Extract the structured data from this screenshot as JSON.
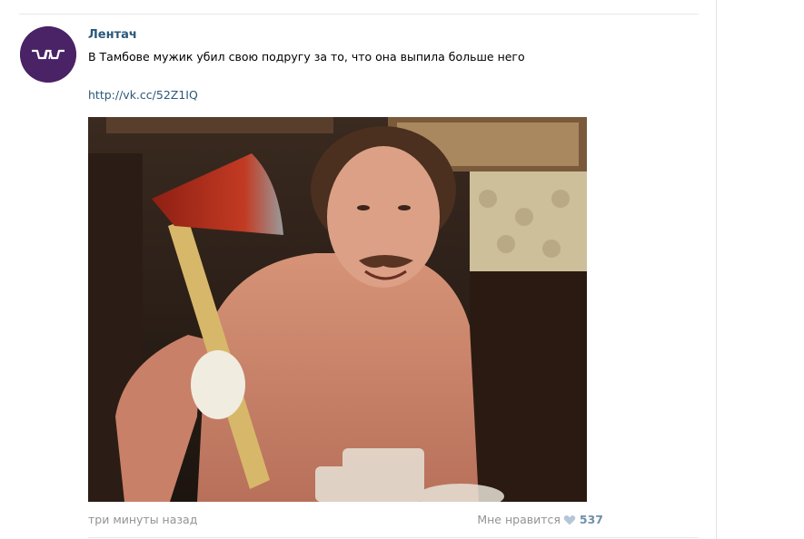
{
  "post": {
    "author": "Лентач",
    "text": "В Тамбове мужик убил свою подругу за то, что она выпила больше него",
    "link": "http://vk.cc/52Z1IQ",
    "timestamp": "три минуты назад",
    "like_label": "Мне нравится",
    "like_count": "537"
  },
  "icons": {
    "avatar": "lentach-logo",
    "like": "heart-icon"
  },
  "colors": {
    "link": "#2b587a",
    "muted": "#939393",
    "avatar_bg": "#4a2266",
    "like_count": "#6f8fa8"
  }
}
